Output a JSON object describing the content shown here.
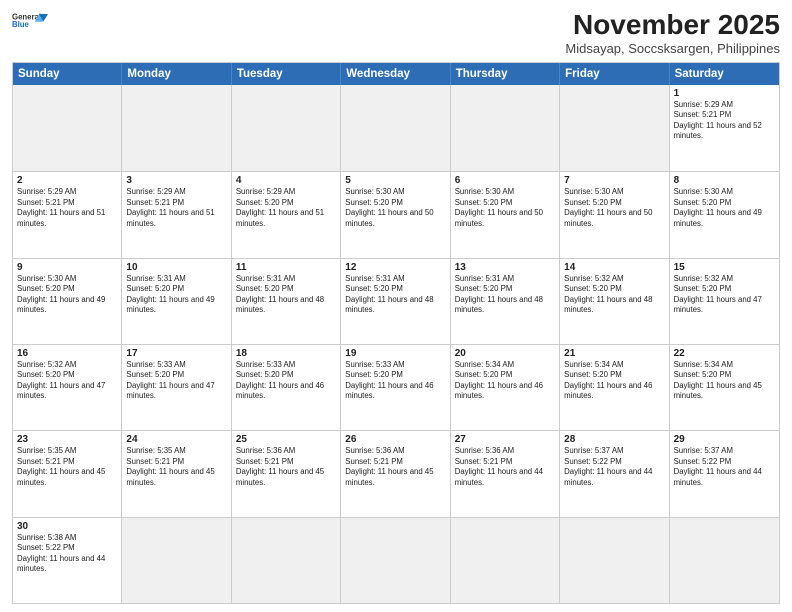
{
  "header": {
    "logo_general": "General",
    "logo_blue": "Blue",
    "month_title": "November 2025",
    "subtitle": "Midsayap, Soccsksargen, Philippines"
  },
  "weekdays": [
    "Sunday",
    "Monday",
    "Tuesday",
    "Wednesday",
    "Thursday",
    "Friday",
    "Saturday"
  ],
  "weeks": [
    [
      {
        "day": "",
        "empty": true
      },
      {
        "day": "",
        "empty": true
      },
      {
        "day": "",
        "empty": true
      },
      {
        "day": "",
        "empty": true
      },
      {
        "day": "",
        "empty": true
      },
      {
        "day": "",
        "empty": true
      },
      {
        "day": "1",
        "sunrise": "5:29 AM",
        "sunset": "5:21 PM",
        "daylight": "11 hours and 52 minutes."
      }
    ],
    [
      {
        "day": "2",
        "sunrise": "5:29 AM",
        "sunset": "5:21 PM",
        "daylight": "11 hours and 51 minutes."
      },
      {
        "day": "3",
        "sunrise": "5:29 AM",
        "sunset": "5:21 PM",
        "daylight": "11 hours and 51 minutes."
      },
      {
        "day": "4",
        "sunrise": "5:29 AM",
        "sunset": "5:20 PM",
        "daylight": "11 hours and 51 minutes."
      },
      {
        "day": "5",
        "sunrise": "5:30 AM",
        "sunset": "5:20 PM",
        "daylight": "11 hours and 50 minutes."
      },
      {
        "day": "6",
        "sunrise": "5:30 AM",
        "sunset": "5:20 PM",
        "daylight": "11 hours and 50 minutes."
      },
      {
        "day": "7",
        "sunrise": "5:30 AM",
        "sunset": "5:20 PM",
        "daylight": "11 hours and 50 minutes."
      },
      {
        "day": "8",
        "sunrise": "5:30 AM",
        "sunset": "5:20 PM",
        "daylight": "11 hours and 49 minutes."
      }
    ],
    [
      {
        "day": "9",
        "sunrise": "5:30 AM",
        "sunset": "5:20 PM",
        "daylight": "11 hours and 49 minutes."
      },
      {
        "day": "10",
        "sunrise": "5:31 AM",
        "sunset": "5:20 PM",
        "daylight": "11 hours and 49 minutes."
      },
      {
        "day": "11",
        "sunrise": "5:31 AM",
        "sunset": "5:20 PM",
        "daylight": "11 hours and 48 minutes."
      },
      {
        "day": "12",
        "sunrise": "5:31 AM",
        "sunset": "5:20 PM",
        "daylight": "11 hours and 48 minutes."
      },
      {
        "day": "13",
        "sunrise": "5:31 AM",
        "sunset": "5:20 PM",
        "daylight": "11 hours and 48 minutes."
      },
      {
        "day": "14",
        "sunrise": "5:32 AM",
        "sunset": "5:20 PM",
        "daylight": "11 hours and 48 minutes."
      },
      {
        "day": "15",
        "sunrise": "5:32 AM",
        "sunset": "5:20 PM",
        "daylight": "11 hours and 47 minutes."
      }
    ],
    [
      {
        "day": "16",
        "sunrise": "5:32 AM",
        "sunset": "5:20 PM",
        "daylight": "11 hours and 47 minutes."
      },
      {
        "day": "17",
        "sunrise": "5:33 AM",
        "sunset": "5:20 PM",
        "daylight": "11 hours and 47 minutes."
      },
      {
        "day": "18",
        "sunrise": "5:33 AM",
        "sunset": "5:20 PM",
        "daylight": "11 hours and 46 minutes."
      },
      {
        "day": "19",
        "sunrise": "5:33 AM",
        "sunset": "5:20 PM",
        "daylight": "11 hours and 46 minutes."
      },
      {
        "day": "20",
        "sunrise": "5:34 AM",
        "sunset": "5:20 PM",
        "daylight": "11 hours and 46 minutes."
      },
      {
        "day": "21",
        "sunrise": "5:34 AM",
        "sunset": "5:20 PM",
        "daylight": "11 hours and 46 minutes."
      },
      {
        "day": "22",
        "sunrise": "5:34 AM",
        "sunset": "5:20 PM",
        "daylight": "11 hours and 45 minutes."
      }
    ],
    [
      {
        "day": "23",
        "sunrise": "5:35 AM",
        "sunset": "5:21 PM",
        "daylight": "11 hours and 45 minutes."
      },
      {
        "day": "24",
        "sunrise": "5:35 AM",
        "sunset": "5:21 PM",
        "daylight": "11 hours and 45 minutes."
      },
      {
        "day": "25",
        "sunrise": "5:36 AM",
        "sunset": "5:21 PM",
        "daylight": "11 hours and 45 minutes."
      },
      {
        "day": "26",
        "sunrise": "5:36 AM",
        "sunset": "5:21 PM",
        "daylight": "11 hours and 45 minutes."
      },
      {
        "day": "27",
        "sunrise": "5:36 AM",
        "sunset": "5:21 PM",
        "daylight": "11 hours and 44 minutes."
      },
      {
        "day": "28",
        "sunrise": "5:37 AM",
        "sunset": "5:22 PM",
        "daylight": "11 hours and 44 minutes."
      },
      {
        "day": "29",
        "sunrise": "5:37 AM",
        "sunset": "5:22 PM",
        "daylight": "11 hours and 44 minutes."
      }
    ],
    [
      {
        "day": "30",
        "sunrise": "5:38 AM",
        "sunset": "5:22 PM",
        "daylight": "11 hours and 44 minutes."
      },
      {
        "day": "",
        "empty": true
      },
      {
        "day": "",
        "empty": true
      },
      {
        "day": "",
        "empty": true
      },
      {
        "day": "",
        "empty": true
      },
      {
        "day": "",
        "empty": true
      },
      {
        "day": "",
        "empty": true
      }
    ]
  ],
  "labels": {
    "sunrise": "Sunrise:",
    "sunset": "Sunset:",
    "daylight": "Daylight:"
  }
}
